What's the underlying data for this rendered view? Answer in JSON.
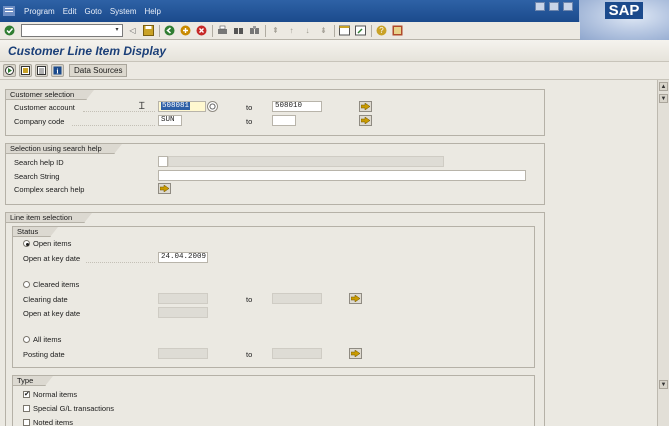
{
  "menu": {
    "items": [
      "Program",
      "Edit",
      "Goto",
      "System",
      "Help"
    ]
  },
  "brand": {
    "logo": "SAP"
  },
  "window": {
    "title": "Customer Line Item Display"
  },
  "app_toolbar": {
    "data_sources_label": "Data Sources"
  },
  "customer_selection": {
    "title": "Customer selection",
    "customer_account_label": "Customer account",
    "customer_account_from": "508081",
    "to_label": "to",
    "customer_account_to": "508010",
    "company_code_label": "Company code",
    "company_code_from": "SUN",
    "company_code_to": ""
  },
  "search_help": {
    "title": "Selection using search help",
    "search_help_id_label": "Search help ID",
    "search_string_label": "Search String",
    "complex_label": "Complex search help"
  },
  "line_item_selection": {
    "title": "Line item selection",
    "status_title": "Status",
    "open_items_label": "Open items",
    "open_at_key_date_label": "Open at key date",
    "open_at_key_date_value": "24.04.2009",
    "cleared_items_label": "Cleared items",
    "clearing_date_label": "Clearing date",
    "to_label": "to",
    "cleared_open_key_date_label": "Open at key date",
    "all_items_label": "All items",
    "posting_date_label": "Posting date",
    "selected_status": "open_items"
  },
  "type": {
    "title": "Type",
    "normal_items_label": "Normal items",
    "normal_items_checked": true,
    "special_gl_label": "Special G/L transactions",
    "noted_items_label": "Noted items"
  },
  "colors": {
    "menubar": "#1b4a8c",
    "title_text": "#1b3f78",
    "selection": "#2e5fa6",
    "push_arrow": "#c99a00"
  }
}
